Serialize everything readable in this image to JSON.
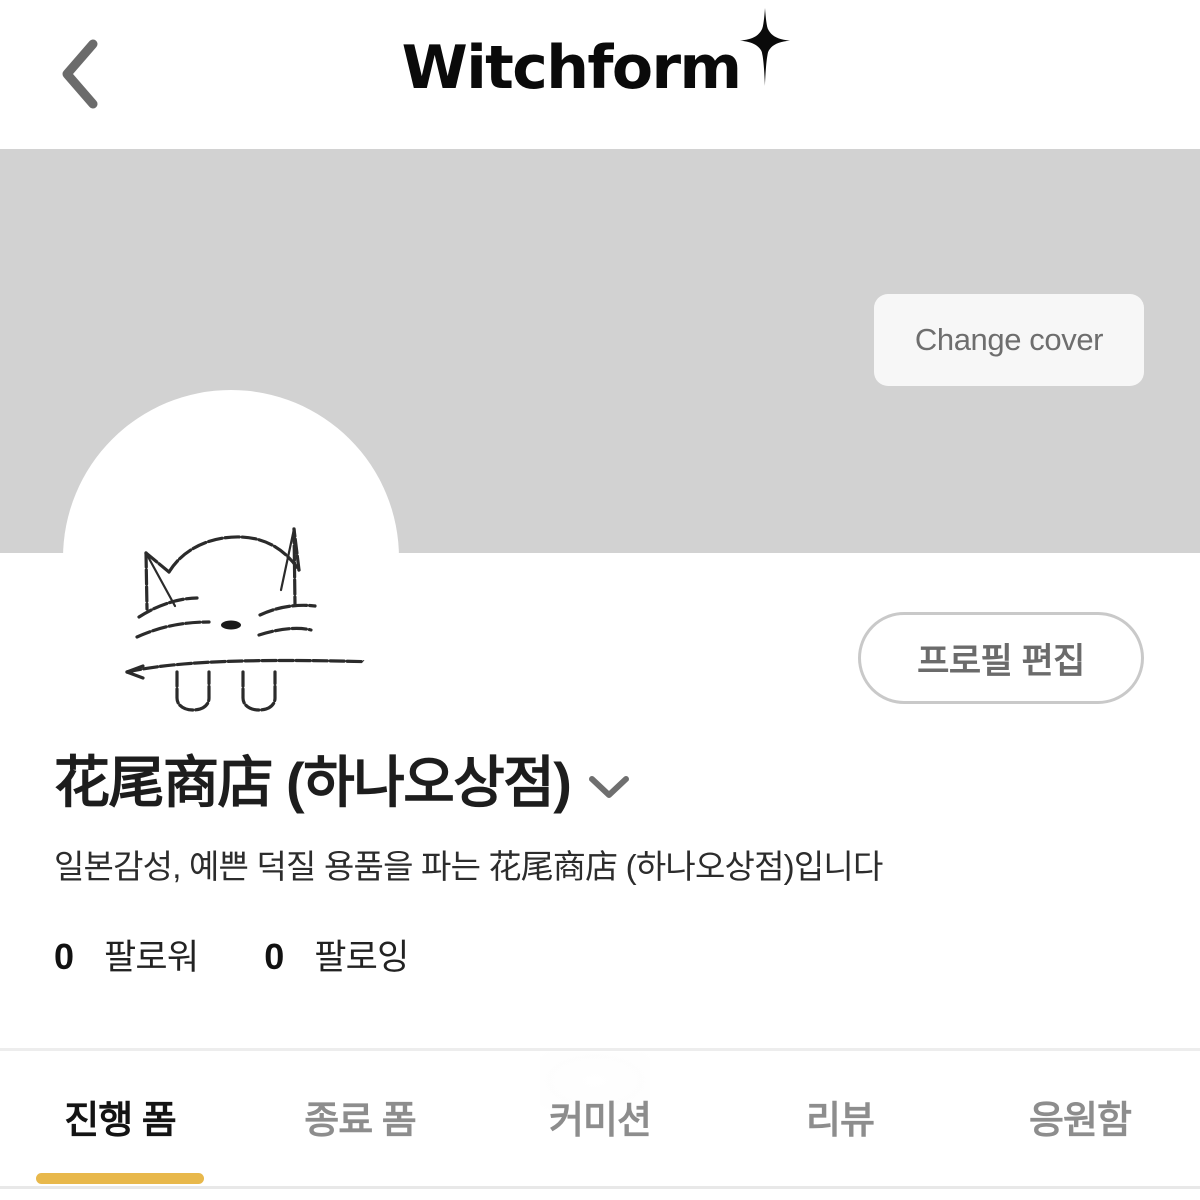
{
  "header": {
    "back_icon": "chevron-left-icon",
    "brand_name": "Witchform",
    "brand_sparkle_icon": "sparkle-star-icon"
  },
  "cover": {
    "change_cover_label": "Change cover",
    "background_color": "#d2d2d2"
  },
  "avatar": {
    "icon": "hand-drawn-cat-avatar",
    "background_color": "#ffffff"
  },
  "actions": {
    "edit_profile_label": "프로필 편집"
  },
  "profile": {
    "name": "花尾商店 (하나오상점)",
    "name_chevron_icon": "chevron-down-icon",
    "bio": "일본감성, 예쁜 덕질 용품을 파는 花尾商店 (하나오상점)입니다",
    "stats": [
      {
        "count": "0",
        "label": "팔로워"
      },
      {
        "count": "0",
        "label": "팔로잉"
      }
    ]
  },
  "tabs": {
    "active_index": 0,
    "active_color": "#e8b84b",
    "items": [
      {
        "label": "진행 폼"
      },
      {
        "label": "종료 폼"
      },
      {
        "label": "커미션"
      },
      {
        "label": "리뷰"
      },
      {
        "label": "응원함"
      }
    ]
  }
}
